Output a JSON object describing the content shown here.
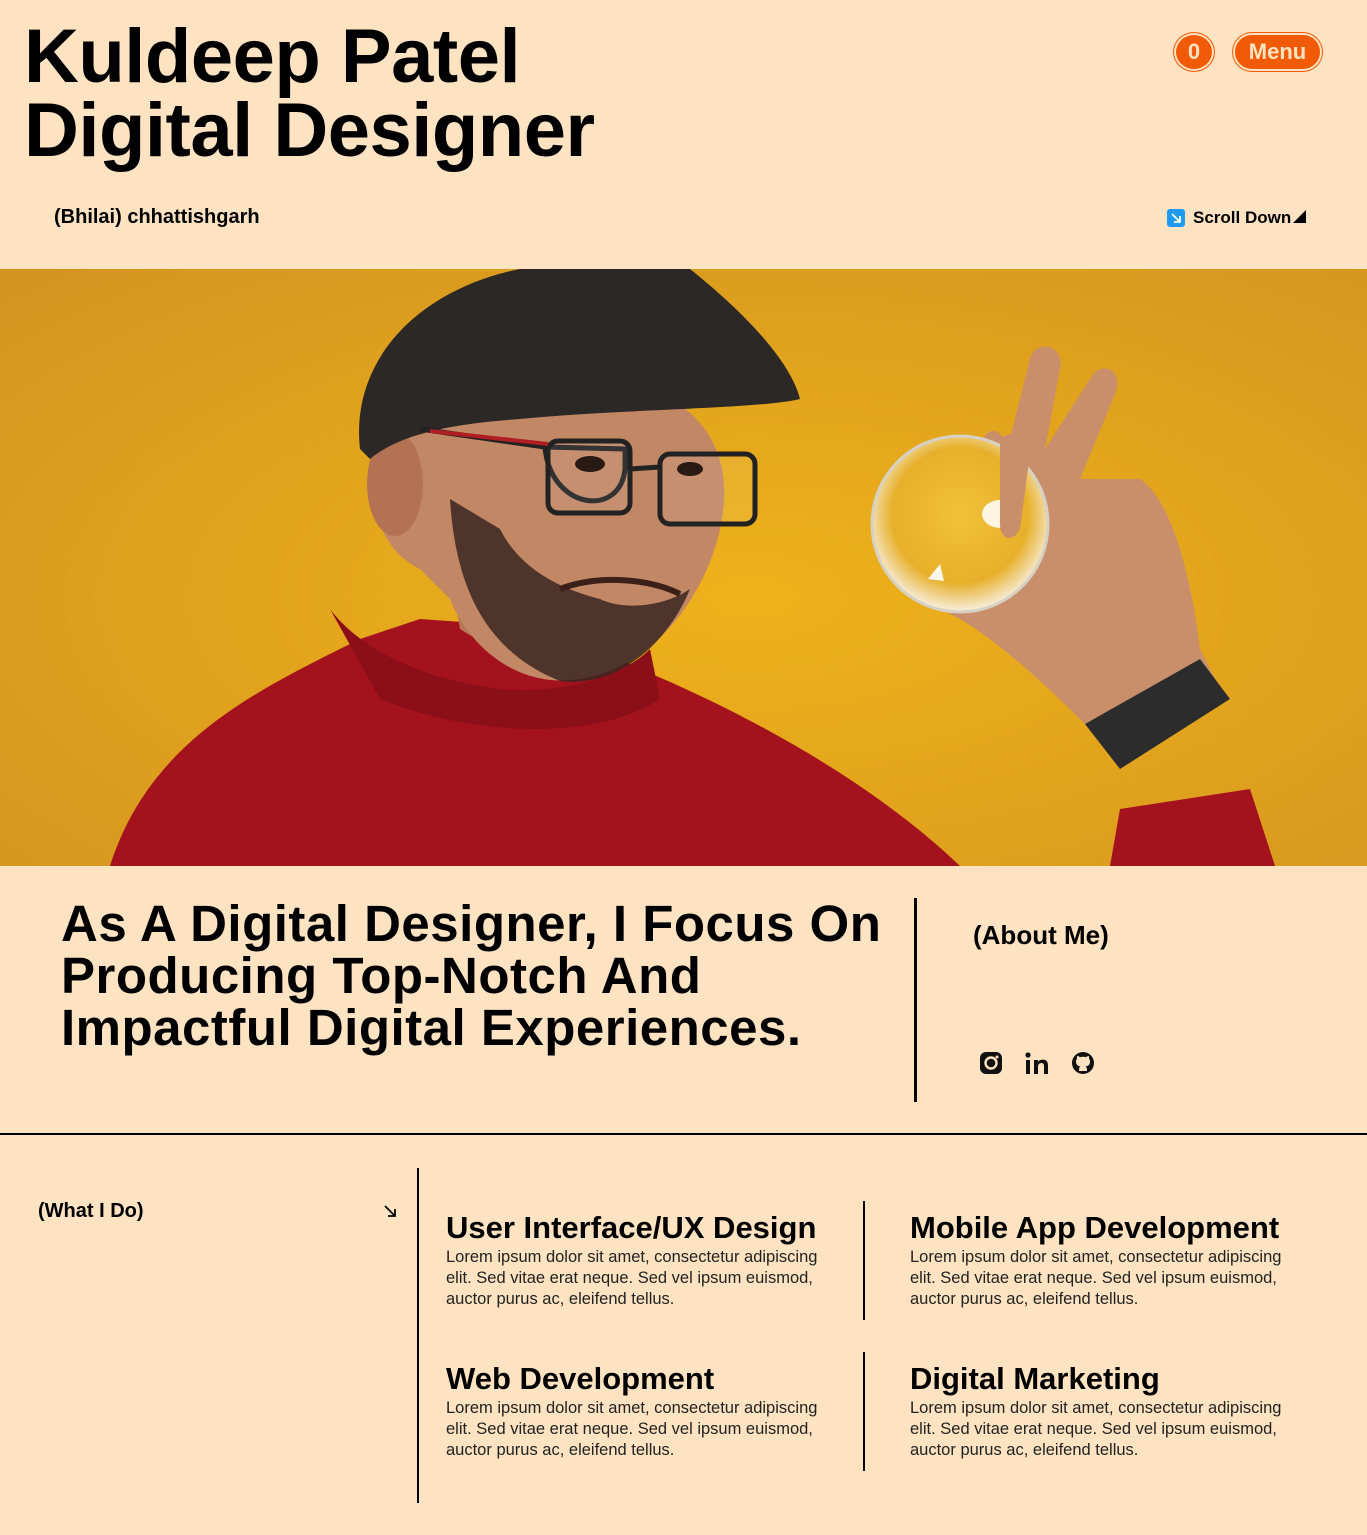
{
  "header": {
    "name": "Kuldeep Patel",
    "role": "Digital Designer",
    "cart_count": "0",
    "menu_label": "Menu",
    "location": "(Bhilai) chhattishgarh",
    "scroll_label": "Scroll Down"
  },
  "about": {
    "heading": "As A Digital Designer, I Focus On Producing Top-Notch And Impactful Digital Experiences.",
    "label": "(About Me)",
    "socials": [
      "instagram-icon",
      "linkedin-icon",
      "github-icon"
    ]
  },
  "services": {
    "label": "(What I Do)",
    "items": [
      {
        "title": "User Interface/UX Design",
        "desc": "Lorem ipsum dolor sit amet, consectetur adipiscing elit. Sed vitae erat neque. Sed vel ipsum euismod, auctor purus ac, eleifend tellus."
      },
      {
        "title": "Mobile App Development",
        "desc": "Lorem ipsum dolor sit amet, consectetur adipiscing elit. Sed vitae erat neque. Sed vel ipsum euismod, auctor purus ac, eleifend tellus."
      },
      {
        "title": "Web Development",
        "desc": "Lorem ipsum dolor sit amet, consectetur adipiscing elit. Sed vitae erat neque. Sed vel ipsum euismod, auctor purus ac, eleifend tellus."
      },
      {
        "title": "Digital Marketing",
        "desc": "Lorem ipsum dolor sit amet, consectetur adipiscing elit. Sed vitae erat neque. Sed vel ipsum euismod, auctor purus ac, eleifend tellus."
      }
    ]
  },
  "colors": {
    "background": "#fde3c1",
    "accent": "#f15a06",
    "photo_backdrop": "#e3a418",
    "sweater": "#a3121d"
  }
}
